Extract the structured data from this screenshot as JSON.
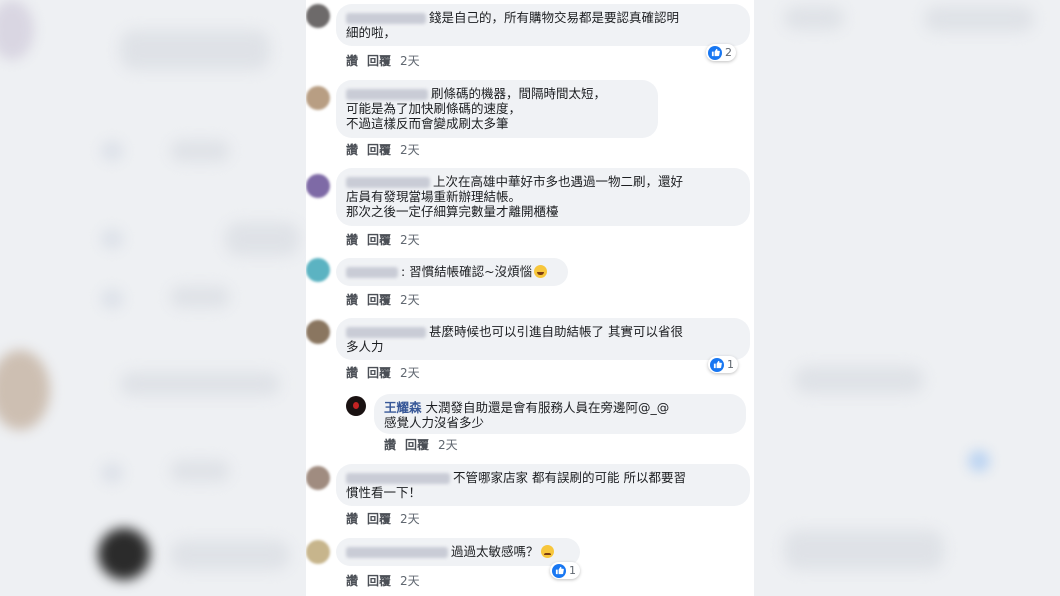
{
  "actions": {
    "like": "讚",
    "reply": "回覆"
  },
  "comments": [
    {
      "lines": [
        "錢是自己的，所有購物交易都是要認真確認明",
        "細的啦，"
      ],
      "time": "2天",
      "reactions": "2"
    },
    {
      "lines": [
        "刷條碼的機器，間隔時間太短，",
        "可能是為了加快刷條碼的速度，",
        "不過這樣反而會變成刷太多筆"
      ],
      "time": "2天"
    },
    {
      "lines": [
        "上次在高雄中華好市多也遇過一物二刷，還好",
        "店員有發現當場重新辦理結帳。",
        "那次之後一定仔細算完數量才離開櫃檯"
      ],
      "time": "2天"
    },
    {
      "lines": [
        ": 習慣結帳確認~沒煩惱"
      ],
      "time": "2天",
      "emoji": "laughing-emoji"
    },
    {
      "lines": [
        "甚麼時候也可以引進自助結帳了 其實可以省很",
        "多人力"
      ],
      "time": "2天",
      "reactions": "1"
    },
    {
      "reply_name": "王耀森",
      "lines": [
        "大潤發自助還是會有服務人員在旁邊阿@_@",
        "感覺人力沒省多少"
      ],
      "time": "2天"
    },
    {
      "lines": [
        "不管哪家店家 都有誤刷的可能 所以都要習",
        "慣性看一下！"
      ],
      "time": "2天"
    },
    {
      "lines": [
        "過過太敏感嗎？"
      ],
      "time": "2天",
      "reactions": "1",
      "emoji": "sad-emoji"
    }
  ],
  "colors": {
    "like_blue": "#1877f2",
    "bubble": "#f0f2f5",
    "reply_name": "#385898"
  }
}
